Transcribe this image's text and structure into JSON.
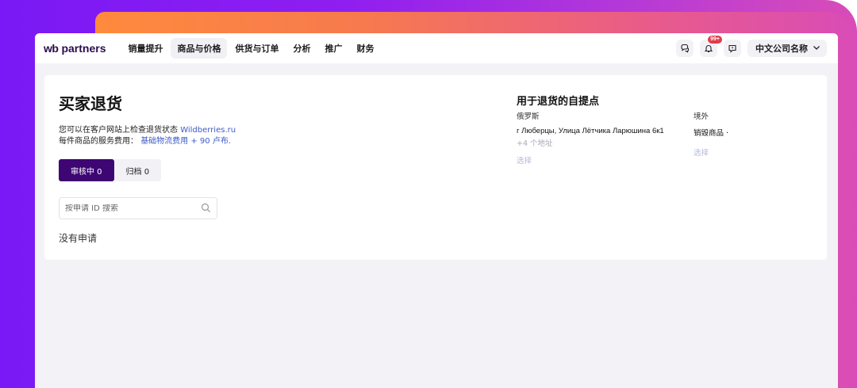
{
  "header": {
    "logo_wb": "wb",
    "logo_partners": "partners",
    "nav": [
      {
        "label": "销量提升",
        "active": false
      },
      {
        "label": "商品与价格",
        "active": true
      },
      {
        "label": "供货与订单",
        "active": false
      },
      {
        "label": "分析",
        "active": false
      },
      {
        "label": "推广",
        "active": false
      },
      {
        "label": "财务",
        "active": false
      }
    ],
    "notification_badge": "99+",
    "company_name": "中文公司名称",
    "icons": [
      "chat-icon",
      "bell-icon",
      "feedback-icon",
      "chevron-down-icon"
    ]
  },
  "page": {
    "title": "买家退货",
    "info_line1_prefix": "您可以在客户网站上检查退货状态",
    "info_line1_link": "Wildberries.ru",
    "info_line2_prefix": "每件商品的服务费用：",
    "info_line2_link": "基础物流费用 + 90 卢布.",
    "tabs": {
      "active": "审核中 0",
      "inactive": "归档 0"
    },
    "search": {
      "placeholder": "按申请 ID 搜索"
    },
    "empty_text": "没有申请"
  },
  "pickup": {
    "title": "用于退货的自提点",
    "russia": {
      "label": "俄罗斯",
      "address": "г Люберцы, Улица Лётчика Ларюшина 6к1",
      "more": "+4 个地址",
      "choose": "选择"
    },
    "abroad": {
      "label": "境外",
      "value": "销毁商品 ·",
      "choose": "选择"
    }
  },
  "colors": {
    "accent": "#3d0673",
    "link": "#3c5bc9",
    "badge": "#e33a4b",
    "frame_purple": "#7a19f5",
    "frame_orange": "#ff8a3d"
  }
}
